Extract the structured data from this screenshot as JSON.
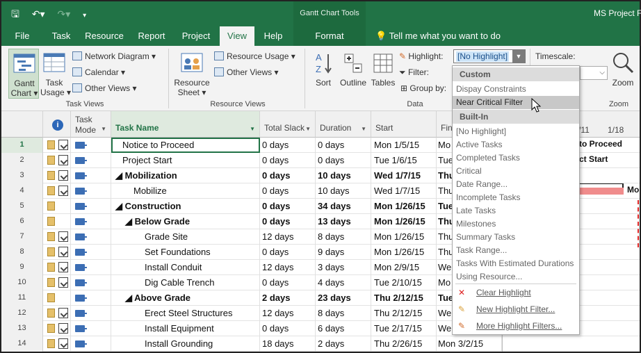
{
  "title": {
    "context_tools": "Gantt Chart Tools",
    "app": "MS Project Fi"
  },
  "tabs": [
    {
      "label": "File"
    },
    {
      "label": "Task"
    },
    {
      "label": "Resource"
    },
    {
      "label": "Report"
    },
    {
      "label": "Project"
    },
    {
      "label": "View"
    },
    {
      "label": "Help"
    },
    {
      "label": "Format"
    }
  ],
  "tell_me": "Tell me what you want to do",
  "ribbon": {
    "gantt_chart": [
      "Gantt",
      "Chart ▾"
    ],
    "task_usage": [
      "Task",
      "Usage ▾"
    ],
    "network_diagram": "Network Diagram ▾",
    "calendar": "Calendar ▾",
    "other_views_task": "Other Views ▾",
    "group_task_views": "Task Views",
    "resource_sheet": [
      "Resource",
      "Sheet ▾"
    ],
    "resource_usage": "Resource Usage ▾",
    "other_views_res": "Other Views ▾",
    "group_resource_views": "Resource Views",
    "sort": "Sort",
    "outline": "Outline",
    "tables": "Tables",
    "highlight_label": "Highlight:",
    "highlight_value": "[No Highlight]",
    "filter_label": "Filter:",
    "group_by_label": "Group by:",
    "group_data": "Data",
    "timescale_label": "Timescale:",
    "zoom": "Zoom",
    "group_zoom": "Zoom"
  },
  "columns": {
    "task_mode": [
      "Task",
      "Mode"
    ],
    "task_name": "Task Name",
    "total_slack": "Total Slack",
    "duration": "Duration",
    "start": "Start",
    "finish": "Fini"
  },
  "chart_header": {
    "d1": "/11",
    "d2": "1/18"
  },
  "rows": [
    {
      "n": "1",
      "name": "Notice to Proceed",
      "slack": "0 days",
      "dur": "0 days",
      "start": "Mon 1/5/15",
      "finish": "Mo"
    },
    {
      "n": "2",
      "name": "Project Start",
      "slack": "0 days",
      "dur": "0 days",
      "start": "Tue 1/6/15",
      "finish": "Tue"
    },
    {
      "n": "3",
      "name": "◢ Mobilization",
      "slack": "0 days",
      "dur": "10 days",
      "start": "Wed 1/7/15",
      "finish": "Thu"
    },
    {
      "n": "4",
      "name": "Mobilize",
      "slack": "0 days",
      "dur": "10 days",
      "start": "Wed 1/7/15",
      "finish": "Thu"
    },
    {
      "n": "5",
      "name": "◢ Construction",
      "slack": "0 days",
      "dur": "34 days",
      "start": "Mon 1/26/15",
      "finish": "Tue"
    },
    {
      "n": "6",
      "name": "◢ Below Grade",
      "slack": "0 days",
      "dur": "13 days",
      "start": "Mon 1/26/15",
      "finish": "Thu"
    },
    {
      "n": "7",
      "name": "Grade Site",
      "slack": "12 days",
      "dur": "8 days",
      "start": "Mon 1/26/15",
      "finish": "Thu"
    },
    {
      "n": "8",
      "name": "Set Foundations",
      "slack": "0 days",
      "dur": "9 days",
      "start": "Mon 1/26/15",
      "finish": "Thu"
    },
    {
      "n": "9",
      "name": "Install Conduit",
      "slack": "12 days",
      "dur": "3 days",
      "start": "Mon 2/9/15",
      "finish": "We"
    },
    {
      "n": "10",
      "name": "Dig Cable Trench",
      "slack": "0 days",
      "dur": "4 days",
      "start": "Tue 2/10/15",
      "finish": "Mo"
    },
    {
      "n": "11",
      "name": "◢ Above Grade",
      "slack": "2 days",
      "dur": "23 days",
      "start": "Thu 2/12/15",
      "finish": "Tue"
    },
    {
      "n": "12",
      "name": "Erect Steel Structures",
      "slack": "12 days",
      "dur": "8 days",
      "start": "Thu 2/12/15",
      "finish": "We"
    },
    {
      "n": "13",
      "name": "Install Equipment",
      "slack": "0 days",
      "dur": "6 days",
      "start": "Tue 2/17/15",
      "finish": "We"
    },
    {
      "n": "14",
      "name": "Install Grounding",
      "slack": "18 days",
      "dur": "2 days",
      "start": "Thu 2/26/15",
      "finish": "Mon 3/2/15"
    }
  ],
  "gantt_labels": {
    "r1": "to Proceed",
    "r2": "ct Start",
    "r4": "Mo"
  },
  "dropdown": {
    "custom_header": "Custom",
    "custom": [
      "Dispay Constraints",
      "Near Critical Filter"
    ],
    "builtin_header": "Built-In",
    "builtin": [
      "[No Highlight]",
      "Active Tasks",
      "Completed Tasks",
      "Critical",
      "Date Range...",
      "Incomplete Tasks",
      "Late Tasks",
      "Milestones",
      "Summary Tasks",
      "Task Range...",
      "Tasks With Estimated Durations",
      "Using Resource..."
    ],
    "commands": [
      "Clear Highlight",
      "New Highlight Filter...",
      "More Highlight Filters..."
    ]
  },
  "colors": {
    "brand": "#217346",
    "critical_bar": "#f08c8c"
  }
}
